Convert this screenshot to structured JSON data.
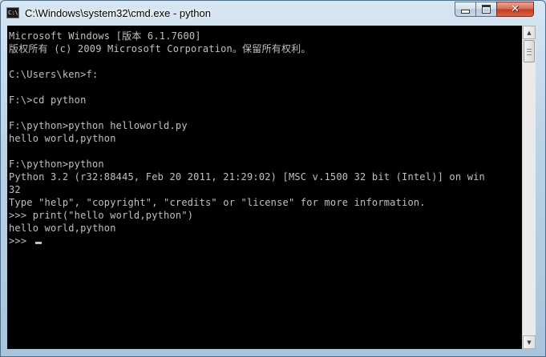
{
  "window": {
    "title": "C:\\Windows\\system32\\cmd.exe - python",
    "icon": "cmd-icon",
    "icon_text": "C:\\",
    "caption": {
      "minimize_icon": "minimize-icon",
      "maximize_icon": "maximize-icon",
      "close_icon": "close-icon",
      "close_glyph": "✕"
    }
  },
  "console": {
    "lines": [
      "Microsoft Windows [版本 6.1.7600]",
      "版权所有 (c) 2009 Microsoft Corporation。保留所有权利。",
      "",
      "C:\\Users\\ken>f:",
      "",
      "F:\\>cd python",
      "",
      "F:\\python>python helloworld.py",
      "hello world,python",
      "",
      "F:\\python>python",
      "Python 3.2 (r32:88445, Feb 20 2011, 21:29:02) [MSC v.1500 32 bit (Intel)] on win",
      "32",
      "Type \"help\", \"copyright\", \"credits\" or \"license\" for more information.",
      ">>> print(\"hello world,python\")",
      "hello world,python"
    ],
    "prompt": ">>> ",
    "text_color": "#c0c0c0",
    "background": "#000000"
  },
  "scrollbar": {
    "up_icon": "scroll-up-arrow-icon",
    "down_icon": "scroll-down-arrow-icon",
    "up_glyph": "▲",
    "down_glyph": "▼"
  }
}
